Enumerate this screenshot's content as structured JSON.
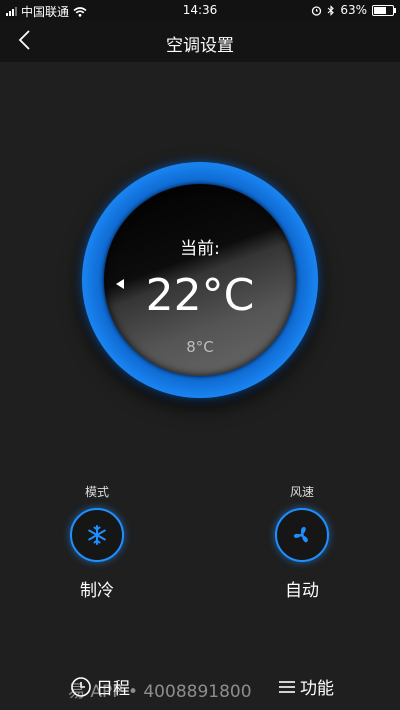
{
  "status_bar": {
    "carrier": "中国联通",
    "time": "14:36",
    "battery": "63%",
    "battery_level": 0.63
  },
  "nav": {
    "title": "空调设置"
  },
  "dial": {
    "label": "当前:",
    "current_temp": "22°C",
    "set_temp": "8°C"
  },
  "controls": {
    "mode": {
      "caption": "模式",
      "value": "制冷",
      "icon": "snowflake-icon"
    },
    "fan": {
      "caption": "风速",
      "value": "自动",
      "icon": "fan-icon"
    }
  },
  "bottom_tabs": {
    "schedule": "日程",
    "functions": "功能"
  },
  "watermark": "易 APP • 4008891800",
  "colors": {
    "accent": "#1e8fff",
    "background": "#1f1f1f",
    "nav_background": "#141414"
  }
}
